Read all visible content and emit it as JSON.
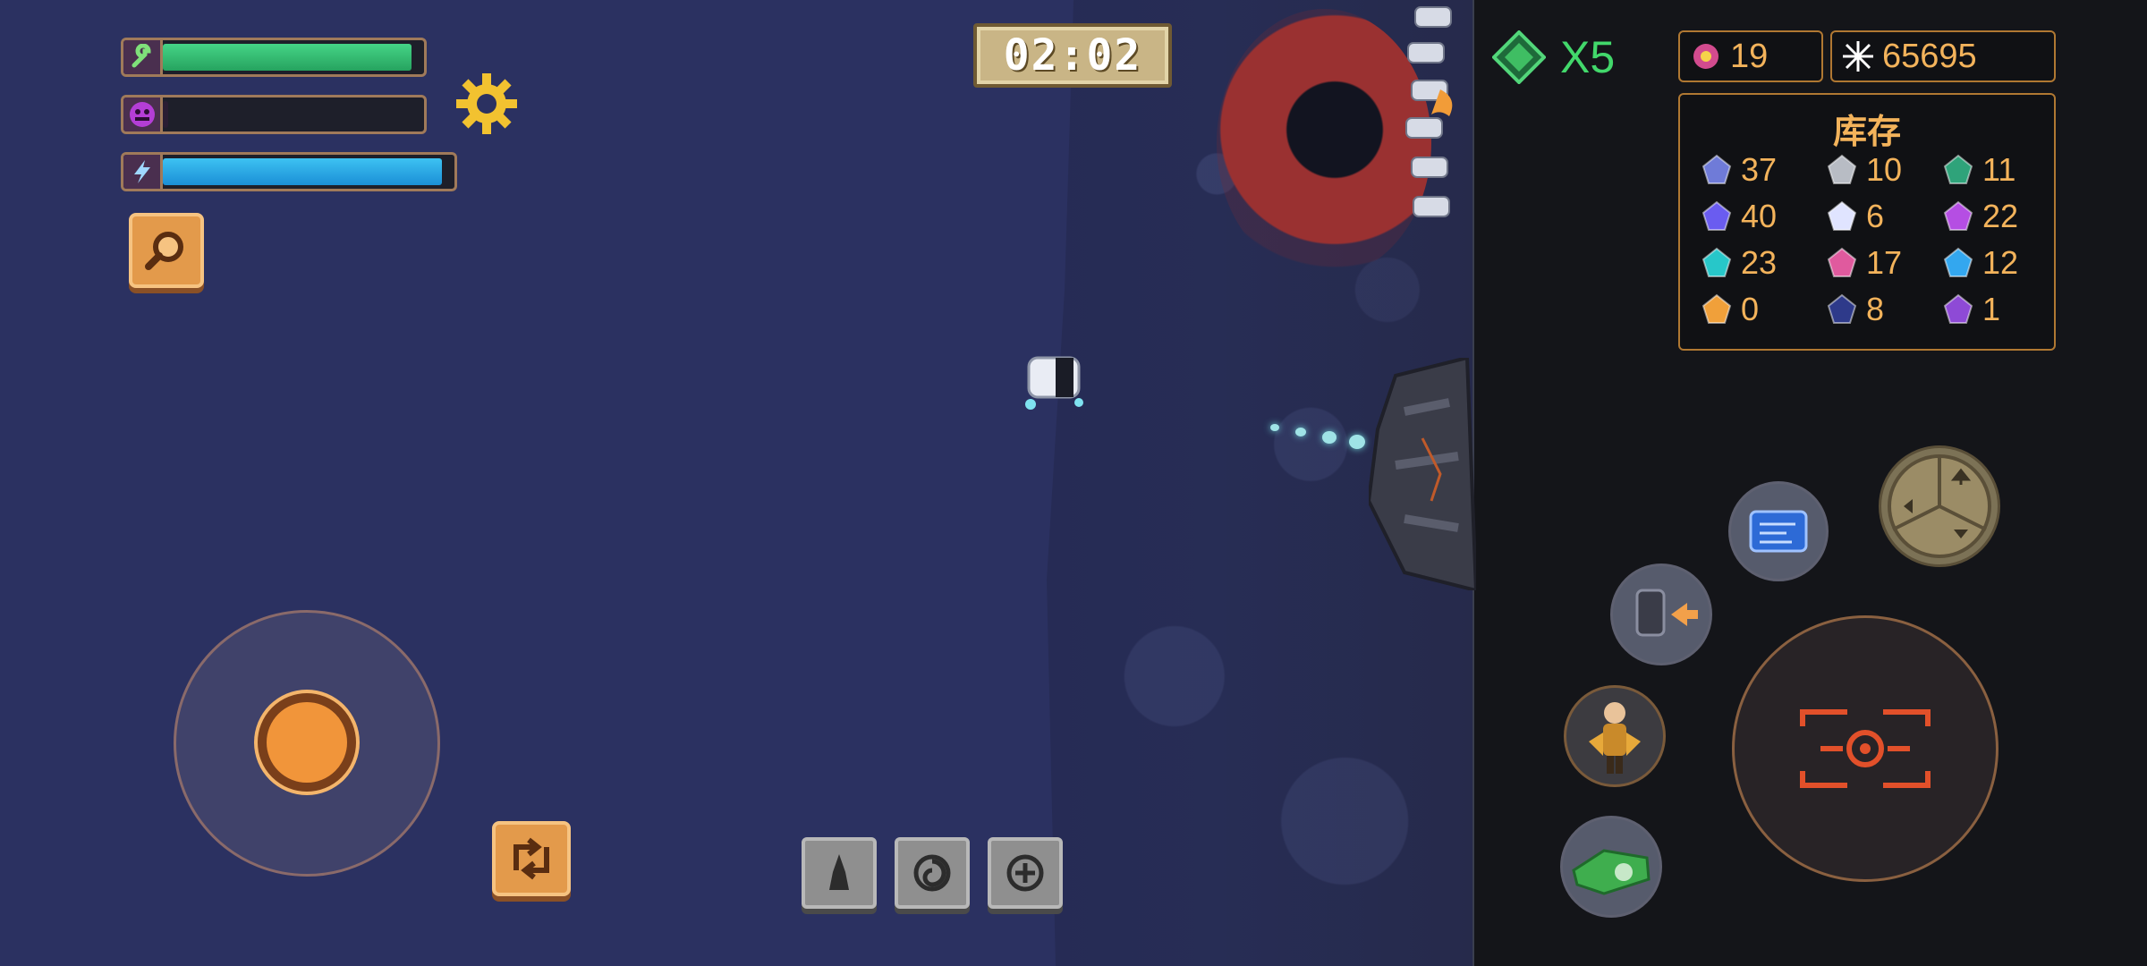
{
  "hud": {
    "bars": [
      {
        "id": "repair",
        "icon": "wrench-icon",
        "fill": 0.98,
        "color": "#35c272"
      },
      {
        "id": "hunger",
        "icon": "monster-face-icon",
        "fill": 0.02,
        "color": "#2a1d33"
      },
      {
        "id": "energy",
        "icon": "lightning-icon",
        "fill": 0.98,
        "color": "#2aa8e6"
      }
    ],
    "timer": "02:02",
    "multiplier": "X5",
    "currency": [
      {
        "icon": "pink-crystal-icon",
        "value": "19"
      },
      {
        "icon": "white-spark-icon",
        "value": "65695"
      }
    ]
  },
  "inventory": {
    "title": "库存",
    "items": [
      {
        "icon": "blue-ore-icon",
        "color": "#6f7bd8",
        "count": "37"
      },
      {
        "icon": "gray-rocket-icon",
        "color": "#b8bcc4",
        "count": "10"
      },
      {
        "icon": "green-capsule-icon",
        "color": "#2fa37a",
        "count": "11"
      },
      {
        "icon": "violet-cluster-icon",
        "color": "#6a5cf0",
        "count": "40"
      },
      {
        "icon": "white-star-icon",
        "color": "#e0e4ff",
        "count": "6"
      },
      {
        "icon": "purple-shard-icon",
        "color": "#b54ee3",
        "count": "22"
      },
      {
        "icon": "cyan-ring-icon",
        "color": "#27c7c9",
        "count": "23"
      },
      {
        "icon": "pink-helix-icon",
        "color": "#e05a9e",
        "count": "17"
      },
      {
        "icon": "blue-cube-icon",
        "color": "#33a7ef",
        "count": "12"
      },
      {
        "icon": "orange-cross-icon",
        "color": "#f0a03a",
        "count": "0"
      },
      {
        "icon": "navy-shard-icon",
        "color": "#2e3a8a",
        "count": "8"
      },
      {
        "icon": "purple-knot-icon",
        "color": "#8e4ad6",
        "count": "1"
      }
    ]
  },
  "controls": {
    "skills": [
      "drill-skill-icon",
      "spiral-skill-icon",
      "vortex-skill-icon"
    ]
  },
  "colors": {
    "hud_gold": "#f3b35b",
    "multiplier_green": "#42d86b",
    "void_blue": "#2b3161",
    "panel_dark": "#141519"
  }
}
